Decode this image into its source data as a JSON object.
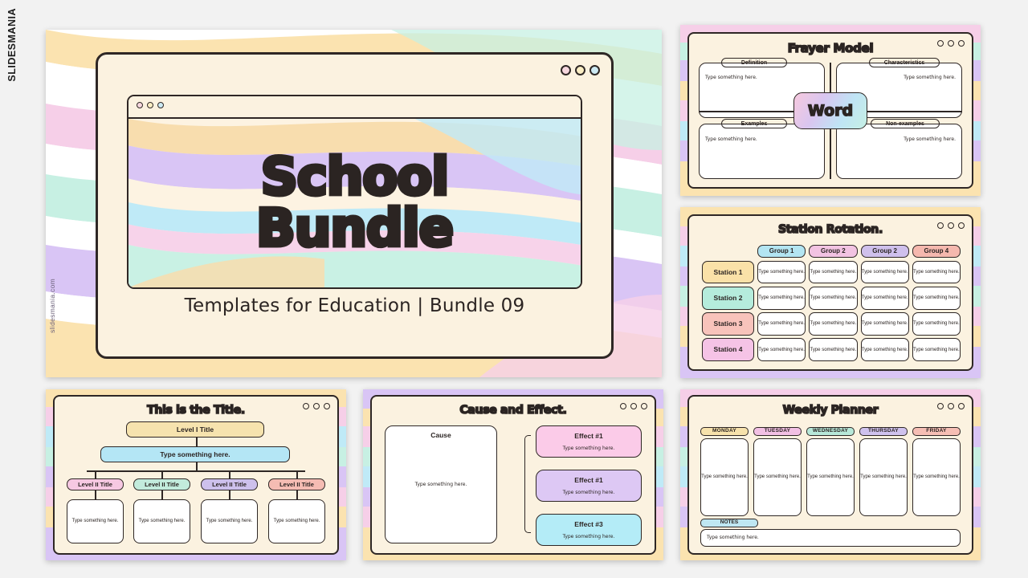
{
  "brand": {
    "vertical_label": "SLIDESMANIA",
    "watermark": "slidesmania.com"
  },
  "common": {
    "placeholder": "Type something here."
  },
  "hero": {
    "title_line1": "School",
    "title_line2": "Bundle",
    "subtitle": "Templates for Education | Bundle 09",
    "window_dots": [
      "pink-dot",
      "yellow-dot",
      "blue-dot"
    ]
  },
  "frayer": {
    "title": "Frayer Model",
    "center_word": "Word",
    "quadrants": [
      {
        "label": "Definition",
        "color": "#f4c8df",
        "body": "Type something here."
      },
      {
        "label": "Characteristics",
        "color": "#cfc6ef",
        "body": "Type something here."
      },
      {
        "label": "Examples",
        "color": "#b9e4f4",
        "body": "Type something here."
      },
      {
        "label": "Non-examples",
        "color": "#f7e7b8",
        "body": "Type something here."
      }
    ]
  },
  "station": {
    "title": "Station Rotation.",
    "groups": [
      {
        "label": "Group 1",
        "color": "#b3e5f2"
      },
      {
        "label": "Group 2",
        "color": "#f2c3e2"
      },
      {
        "label": "Group 2",
        "color": "#cfc0ec"
      },
      {
        "label": "Group 4",
        "color": "#f5b8ae"
      }
    ],
    "stations": [
      {
        "label": "Station 1",
        "color": "#fae1a8"
      },
      {
        "label": "Station 2",
        "color": "#b5ecdc"
      },
      {
        "label": "Station 3",
        "color": "#f8c3bb"
      },
      {
        "label": "Station 4",
        "color": "#f5c3e6"
      }
    ],
    "cell_placeholder": "Type something here."
  },
  "org": {
    "title": "This is the Title.",
    "level1": {
      "label": "Level I Title",
      "color": "#f6e3ae"
    },
    "level_mid": {
      "label": "Type something here.",
      "color": "#b4e6f5"
    },
    "level2": [
      {
        "label": "Level II Title",
        "color": "#f6c8e2",
        "body": "Type something here."
      },
      {
        "label": "Level II Title",
        "color": "#c2ebdc",
        "body": "Type something here."
      },
      {
        "label": "Level II Title",
        "color": "#cdc0ec",
        "body": "Type something here."
      },
      {
        "label": "Level II Title",
        "color": "#f5bcb3",
        "body": "Type something here."
      }
    ]
  },
  "cause": {
    "title": "Cause and Effect.",
    "cause_label": "Cause",
    "cause_placeholder": "Type something here.",
    "effects": [
      {
        "label": "Effect #1",
        "color": "#fbcbe8",
        "body": "Type something here."
      },
      {
        "label": "Effect #1",
        "color": "#ddc8f4",
        "body": "Type something here."
      },
      {
        "label": "Effect #3",
        "color": "#b4ecf7",
        "body": "Type something here."
      }
    ]
  },
  "week": {
    "title": "Weekly Planner",
    "days": [
      {
        "label": "MONDAY",
        "color": "#f7e2ab",
        "body": "Type something here."
      },
      {
        "label": "TUESDAY",
        "color": "#f2c0e4",
        "body": "Type something here."
      },
      {
        "label": "WEDNESDAY",
        "color": "#b7e8d9",
        "body": "Type something here."
      },
      {
        "label": "THURSDAY",
        "color": "#cfc2ee",
        "body": "Type something here."
      },
      {
        "label": "FRIDAY",
        "color": "#f6beb4",
        "body": "Type something here."
      }
    ],
    "notes_label": "NOTES",
    "notes_placeholder": "Type something here."
  }
}
